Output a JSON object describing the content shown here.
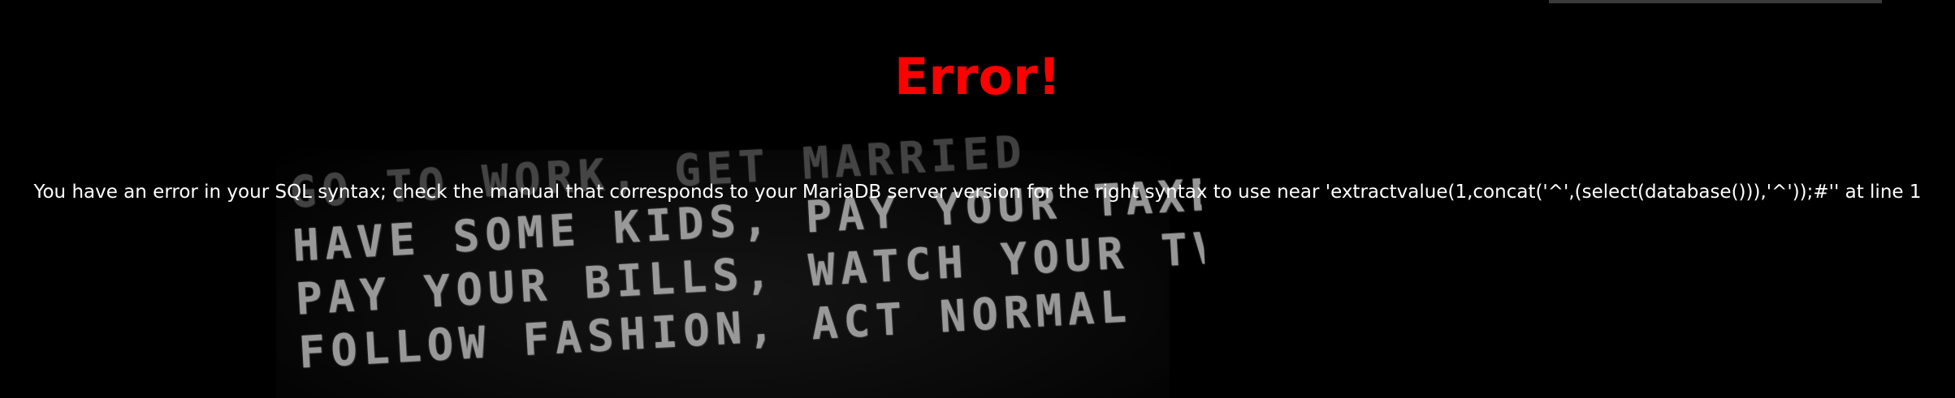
{
  "page": {
    "title": "Error!",
    "message": "You have an error in your SQL syntax; check the manual that corresponds to your MariaDB server version for the right syntax to use near 'extractvalue(1,concat('^',(select(database())),'^'));#'' at line 1"
  },
  "background_image": {
    "lines": [
      "GO TO WORK, GET MARRIED",
      "HAVE SOME KIDS, PAY YOUR TAXES",
      "PAY YOUR BILLS, WATCH YOUR TV",
      "FOLLOW FASHION, ACT NORMAL"
    ]
  },
  "colors": {
    "background": "#000000",
    "error_title": "#ff0000",
    "message_text": "#ffffff"
  }
}
